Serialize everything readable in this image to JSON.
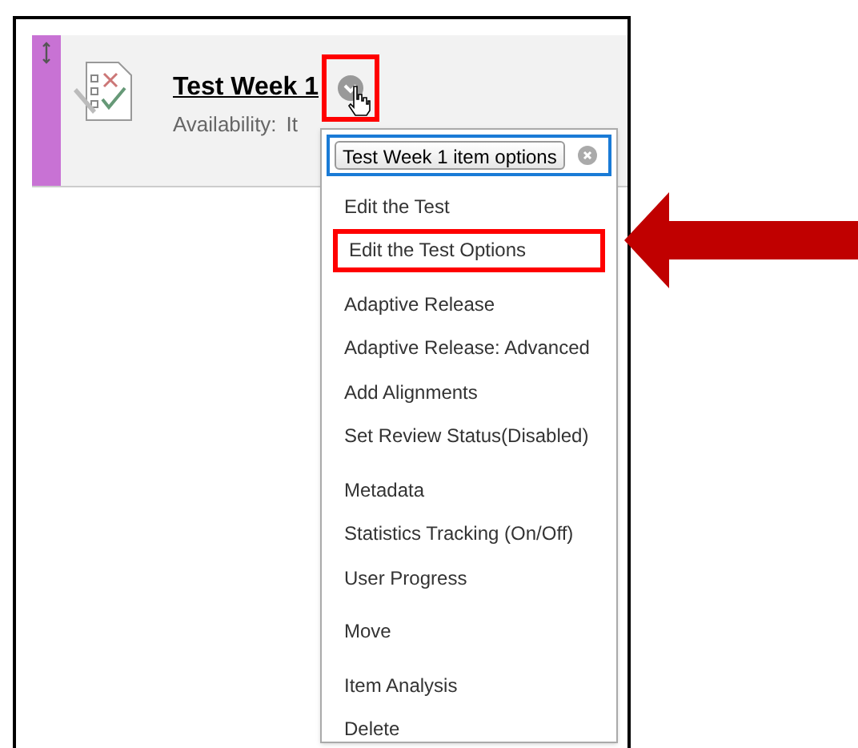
{
  "item": {
    "title": "Test Week 1",
    "options_button": {
      "highlighted": true
    },
    "availability_label": "Availability:",
    "availability_value": "It"
  },
  "menu": {
    "header_button": "Test Week 1 item options",
    "groups": [
      [
        {
          "label": "Edit the Test",
          "highlighted": false
        },
        {
          "label": "Edit the Test Options",
          "highlighted": true
        }
      ],
      [
        {
          "label": "Adaptive Release",
          "highlighted": false
        },
        {
          "label": "Adaptive Release: Advanced",
          "highlighted": false
        },
        {
          "label": "Add Alignments",
          "highlighted": false
        },
        {
          "label": "Set Review Status(Disabled)",
          "highlighted": false
        }
      ],
      [
        {
          "label": "Metadata",
          "highlighted": false
        },
        {
          "label": "Statistics Tracking (On/Off)",
          "highlighted": false
        },
        {
          "label": "User Progress",
          "highlighted": false
        }
      ],
      [
        {
          "label": "Move",
          "highlighted": false
        }
      ],
      [
        {
          "label": "Item Analysis",
          "highlighted": false
        },
        {
          "label": "Delete",
          "highlighted": false
        }
      ]
    ]
  },
  "annotation": {
    "arrow": true
  }
}
